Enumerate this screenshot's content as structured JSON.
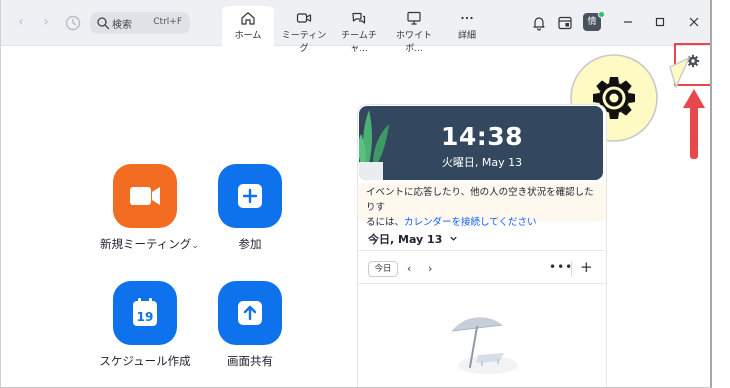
{
  "titlebar": {
    "search_placeholder": "検索",
    "search_shortcut": "Ctrl+F",
    "tabs": [
      {
        "label": "ホーム",
        "icon": "home-icon",
        "active": true
      },
      {
        "label": "ミーティング",
        "icon": "video-camera-icon",
        "active": false
      },
      {
        "label": "チームチャ...",
        "icon": "chat-icon",
        "active": false
      },
      {
        "label": "ホワイトボ...",
        "icon": "whiteboard-icon",
        "active": false
      },
      {
        "label": "詳細",
        "icon": "more-icon",
        "active": false
      }
    ],
    "avatar_initial": "情",
    "presence_color": "#2ec16c"
  },
  "actions": {
    "new_meeting": "新規ミーティング",
    "new_meeting_caret": "⌄",
    "join": "参加",
    "schedule": "スケジュール作成",
    "schedule_day": "19",
    "share_screen": "画面共有"
  },
  "calendar": {
    "time": "14:38",
    "date": "火曜日, May 13",
    "notice_line1": "イベントに応答したり、他の人の空き状況を確認したりす",
    "notice_line2_prefix": "るには、",
    "notice_link": "カレンダーを接続してください",
    "today_label": "今日, May 13",
    "today_button": "今日",
    "prev": "‹",
    "next": "›",
    "more": "•••",
    "add": "+"
  },
  "colors": {
    "orange": "#f26d21",
    "blue": "#0e72ed",
    "highlight_red": "#e8474c",
    "clock_bg": "#33485e"
  }
}
